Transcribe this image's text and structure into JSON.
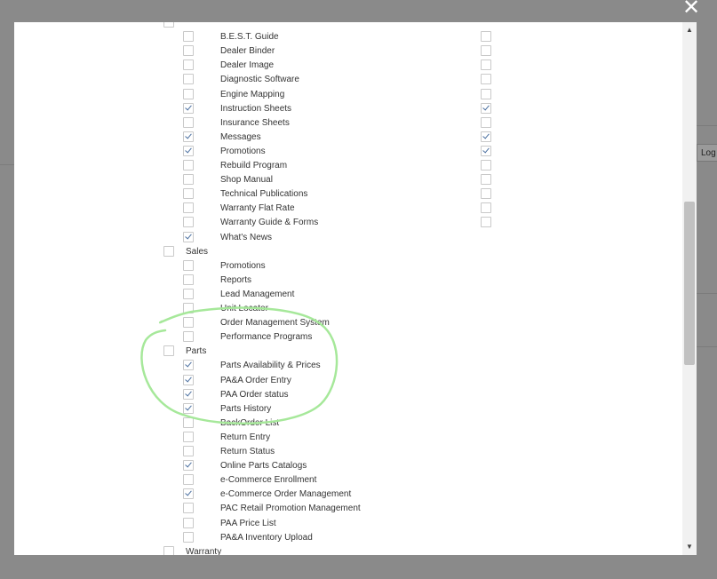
{
  "backdrop": {
    "tab_label": "Log"
  },
  "modal": {
    "close_symbol": "✕",
    "rows": [
      {
        "label": "",
        "level": 0,
        "checked": false,
        "partial": true
      },
      {
        "label": "B.E.S.T. Guide",
        "level": 1,
        "checked": false,
        "col2": false
      },
      {
        "label": "Dealer Binder",
        "level": 1,
        "checked": false,
        "col2": false
      },
      {
        "label": "Dealer Image",
        "level": 1,
        "checked": false,
        "col2": false
      },
      {
        "label": "Diagnostic Software",
        "level": 1,
        "checked": false,
        "col2": false
      },
      {
        "label": "Engine Mapping",
        "level": 1,
        "checked": false,
        "col2": false
      },
      {
        "label": "Instruction Sheets",
        "level": 1,
        "checked": true,
        "col2": true
      },
      {
        "label": "Insurance Sheets",
        "level": 1,
        "checked": false,
        "col2": false
      },
      {
        "label": "Messages",
        "level": 1,
        "checked": true,
        "col2": true
      },
      {
        "label": "Promotions",
        "level": 1,
        "checked": true,
        "col2": true
      },
      {
        "label": "Rebuild Program",
        "level": 1,
        "checked": false,
        "col2": false
      },
      {
        "label": "Shop Manual",
        "level": 1,
        "checked": false,
        "col2": false
      },
      {
        "label": "Technical Publications",
        "level": 1,
        "checked": false,
        "col2": false
      },
      {
        "label": "Warranty Flat Rate",
        "level": 1,
        "checked": false,
        "col2": false
      },
      {
        "label": "Warranty Guide & Forms",
        "level": 1,
        "checked": false,
        "col2": false
      },
      {
        "label": "What's News",
        "level": 1,
        "checked": true
      },
      {
        "label": "Sales",
        "level": 0,
        "checked": false
      },
      {
        "label": "Promotions",
        "level": 1,
        "checked": false
      },
      {
        "label": "Reports",
        "level": 1,
        "checked": false
      },
      {
        "label": "Lead Management",
        "level": 1,
        "checked": false
      },
      {
        "label": "Unit Locator",
        "level": 1,
        "checked": false
      },
      {
        "label": "Order Management System",
        "level": 1,
        "checked": false
      },
      {
        "label": "Performance Programs",
        "level": 1,
        "checked": false
      },
      {
        "label": "Parts",
        "level": 0,
        "checked": false
      },
      {
        "label": "Parts Availability & Prices",
        "level": 1,
        "checked": true
      },
      {
        "label": "PA&A Order Entry",
        "level": 1,
        "checked": true
      },
      {
        "label": "PAA Order status",
        "level": 1,
        "checked": true
      },
      {
        "label": "Parts History",
        "level": 1,
        "checked": true
      },
      {
        "label": "BackOrder List",
        "level": 1,
        "checked": false
      },
      {
        "label": "Return Entry",
        "level": 1,
        "checked": false
      },
      {
        "label": "Return Status",
        "level": 1,
        "checked": false
      },
      {
        "label": "Online Parts Catalogs",
        "level": 1,
        "checked": true
      },
      {
        "label": "e-Commerce Enrollment",
        "level": 1,
        "checked": false
      },
      {
        "label": "e-Commerce Order Management",
        "level": 1,
        "checked": true
      },
      {
        "label": "PAC Retail Promotion Management",
        "level": 1,
        "checked": false
      },
      {
        "label": "PAA Price List",
        "level": 1,
        "checked": false
      },
      {
        "label": "PA&A Inventory Upload",
        "level": 1,
        "checked": false
      },
      {
        "label": "Warranty",
        "level": 0,
        "checked": false
      }
    ]
  },
  "scrollbar": {
    "up_arrow": "▲",
    "down_arrow": "▼"
  },
  "annotation": {
    "color": "#a6e89a"
  }
}
